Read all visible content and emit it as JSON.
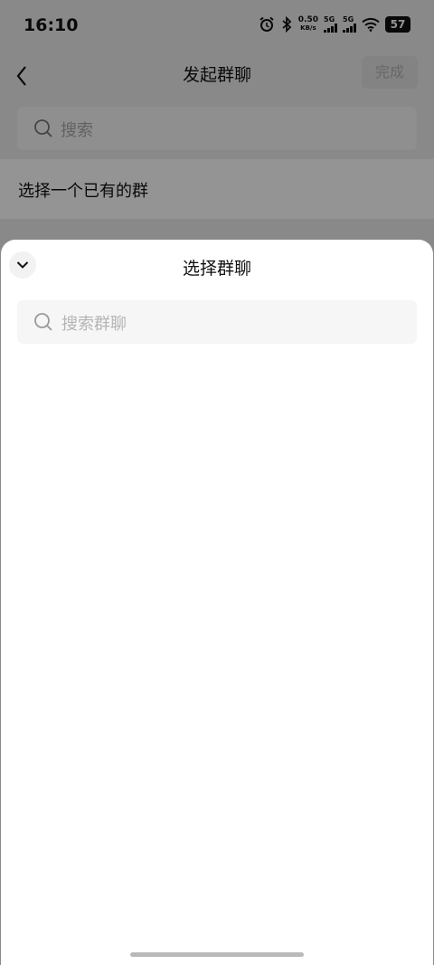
{
  "status_bar": {
    "time": "16:10",
    "net_speed": "0.50",
    "net_unit": "KB/s",
    "sim1_label": "5G",
    "sim2_label": "5G",
    "battery": "57"
  },
  "nav": {
    "title": "发起群聊",
    "done_label": "完成"
  },
  "search": {
    "placeholder": "搜索"
  },
  "choose_existing": {
    "label": "选择一个已有的群"
  },
  "sheet": {
    "title": "选择群聊",
    "search_placeholder": "搜索群聊"
  }
}
